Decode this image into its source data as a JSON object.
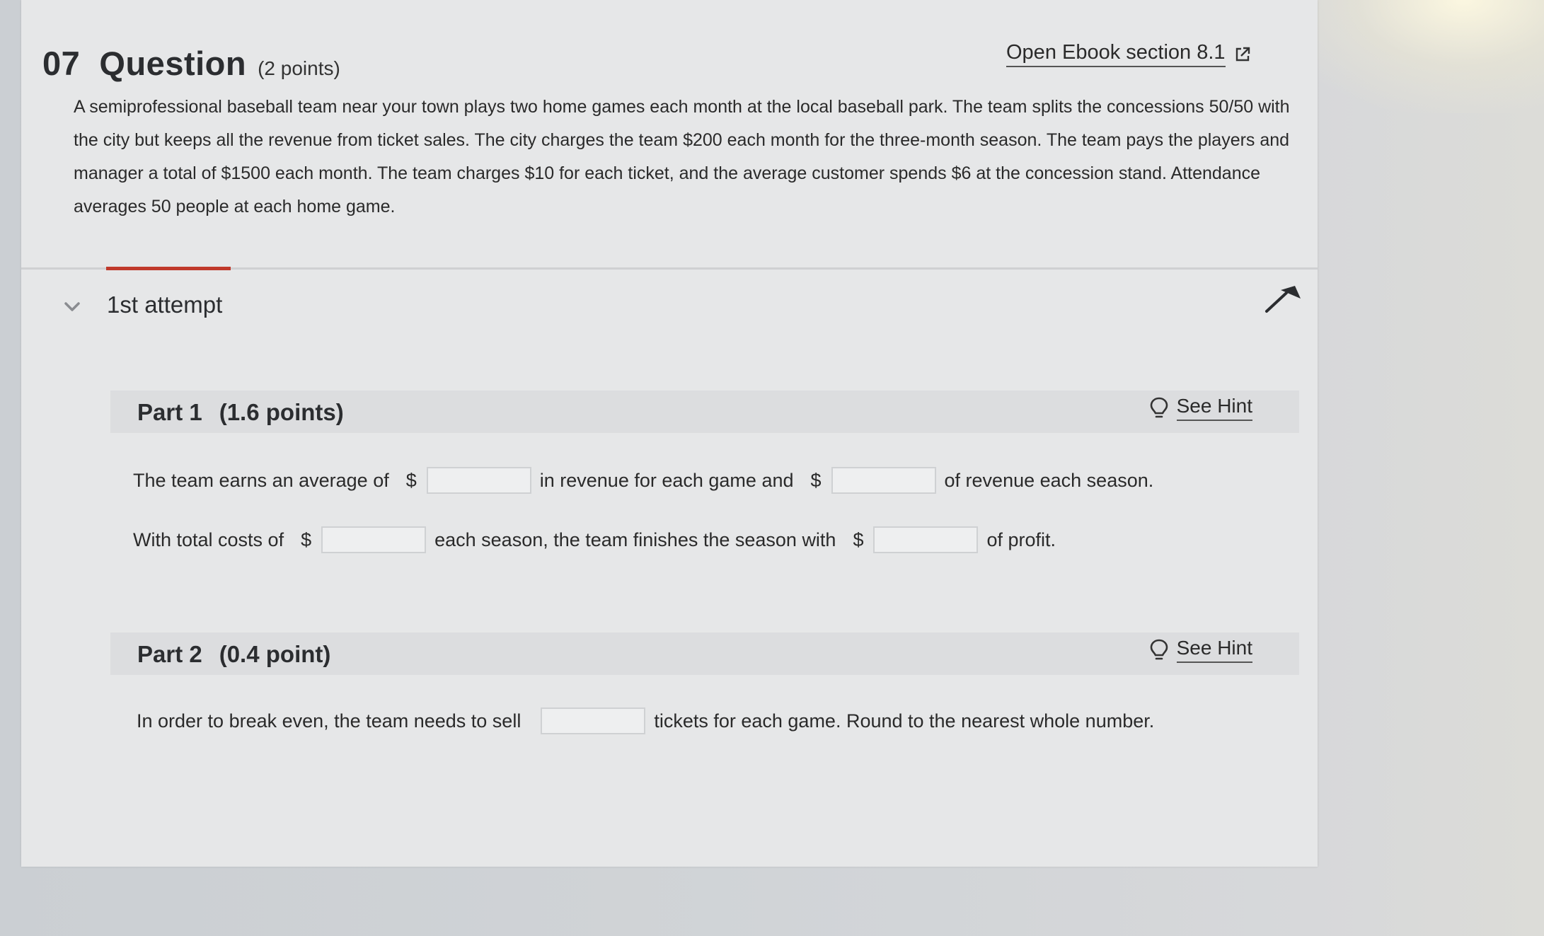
{
  "question": {
    "number": "07",
    "title": "Question",
    "points": "(2 points)",
    "ebook_link": "Open Ebook section 8.1",
    "prompt": "A semiprofessional baseball team near your town plays two home games each month at the local baseball park. The team splits the concessions 50/50 with the city but keeps all the revenue from ticket sales. The city charges the team $200  each month for the three-month season. The team pays the players and manager a total of $1500 each month. The team charges $10 for each ticket, and the average customer spends $6 at the concession stand. Attendance averages  50 people at each home game."
  },
  "attempt": {
    "label": "1st attempt"
  },
  "part1": {
    "name": "Part 1",
    "points": "(1.6 points)",
    "hint": "See Hint",
    "line1": {
      "t1": "The team earns an average of",
      "d1": "$",
      "t2": "in revenue for each game and",
      "d2": "$",
      "t3": "of revenue each season."
    },
    "line2": {
      "t1": "With total costs of",
      "d1": "$",
      "t2": "each season, the team finishes the season with",
      "d2": "$",
      "t3": "of profit."
    }
  },
  "part2": {
    "name": "Part 2",
    "points": "(0.4 point)",
    "hint": "See Hint",
    "line1": {
      "t1": "In order to break even, the team needs to sell",
      "t2": "tickets for each game. Round to the nearest whole number."
    }
  },
  "inputs": {
    "revenue_per_game": "",
    "revenue_per_season": "",
    "total_costs": "",
    "profit": "",
    "tickets_break_even": ""
  },
  "colors": {
    "accent": "#c0392b",
    "card": "#e6e7e8",
    "part_bar": "#dcdddf"
  },
  "icons": {
    "ebook": "external-link-icon",
    "toggle": "chevron-down-icon",
    "pin": "pin-icon",
    "hint": "lightbulb-icon"
  }
}
